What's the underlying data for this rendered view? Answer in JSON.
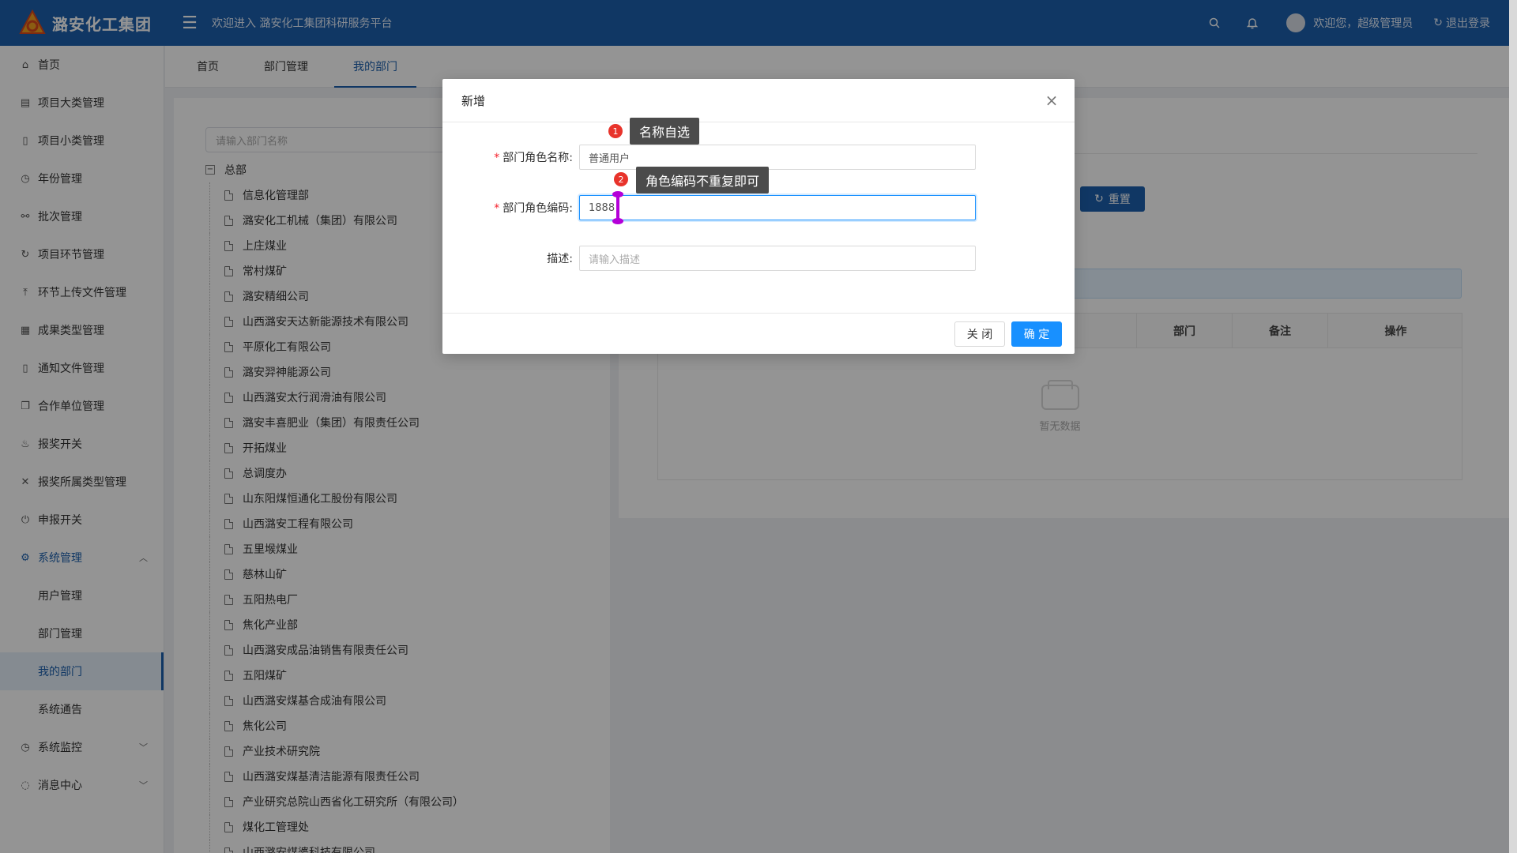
{
  "header": {
    "logo_text": "潞安化工集团",
    "welcome": "欢迎进入 潞安化工集团科研服务平台",
    "greeting": "欢迎您，超级管理员",
    "logout": "退出登录"
  },
  "sidebar": {
    "items": [
      {
        "label": "首页",
        "icon": "home-icon"
      },
      {
        "label": "项目大类管理",
        "icon": "calendar-icon"
      },
      {
        "label": "项目小类管理",
        "icon": "file-icon"
      },
      {
        "label": "年份管理",
        "icon": "dashboard-icon"
      },
      {
        "label": "批次管理",
        "icon": "link-icon"
      },
      {
        "label": "项目环节管理",
        "icon": "refresh-icon"
      },
      {
        "label": "环节上传文件管理",
        "icon": "upload-icon"
      },
      {
        "label": "成果类型管理",
        "icon": "table-icon"
      },
      {
        "label": "通知文件管理",
        "icon": "document-icon"
      },
      {
        "label": "合作单位管理",
        "icon": "copy-icon"
      },
      {
        "label": "报奖开关",
        "icon": "fire-icon"
      },
      {
        "label": "报奖所属类型管理",
        "icon": "shrink-icon"
      },
      {
        "label": "申报开关",
        "icon": "power-icon"
      },
      {
        "label": "系统管理",
        "icon": "gear-icon"
      },
      {
        "label": "用户管理"
      },
      {
        "label": "部门管理"
      },
      {
        "label": "我的部门"
      },
      {
        "label": "系统通告"
      },
      {
        "label": "系统监控",
        "icon": "monitor-icon"
      },
      {
        "label": "消息中心",
        "icon": "message-icon"
      }
    ]
  },
  "tabs": [
    "首页",
    "部门管理",
    "我的部门"
  ],
  "tree": {
    "search_placeholder": "请输入部门名称",
    "root": "总部",
    "nodes": [
      "信息化管理部",
      "潞安化工机械（集团）有限公司",
      "上庄煤业",
      "常村煤矿",
      "潞安精细公司",
      "山西潞安天达新能源技术有限公司",
      "平原化工有限公司",
      "潞安羿神能源公司",
      "山西潞安太行润滑油有限公司",
      "潞安丰喜肥业（集团）有限责任公司",
      "开拓煤业",
      "总调度办",
      "山东阳煤恒通化工股份有限公司",
      "山西潞安工程有限公司",
      "五里堠煤业",
      "慈林山矿",
      "五阳热电厂",
      "焦化产业部",
      "山西潞安成品油销售有限责任公司",
      "五阳煤矿",
      "山西潞安煤基合成油有限公司",
      "焦化公司",
      "产业技术研究院",
      "山西潞安煤基清洁能源有限责任公司",
      "产业研究总院山西省化工研究所（有限公司）",
      "煤化工管理处",
      "山西潞安煤婆科技有限公司"
    ]
  },
  "right_panel": {
    "reset_label": "重置",
    "columns": [
      "部门",
      "备注",
      "操作"
    ],
    "empty_text": "暂无数据"
  },
  "modal": {
    "title": "新增",
    "fields": [
      {
        "label": "部门角色名称:",
        "value": "普通用户",
        "required": true
      },
      {
        "label": "部门角色编码:",
        "value": "1888",
        "required": true
      },
      {
        "label": "描述:",
        "placeholder": "请输入描述",
        "required": false
      }
    ],
    "close_label": "关 闭",
    "ok_label": "确 定"
  },
  "tips": [
    {
      "num": "1",
      "text": "名称自选"
    },
    {
      "num": "2",
      "text": "角色编码不重复即可"
    }
  ],
  "colors": {
    "primary": "#1c60ad",
    "button_primary": "#1890ff",
    "required": "#f5222d"
  }
}
